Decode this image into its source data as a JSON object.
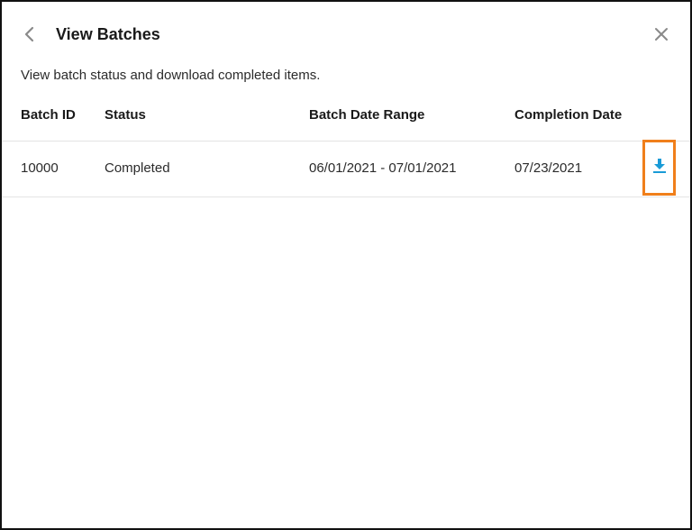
{
  "header": {
    "title": "View Batches",
    "back_icon": "chevron-left-icon",
    "close_icon": "close-icon"
  },
  "subtitle": "View batch status and download completed items.",
  "table": {
    "columns": [
      "Batch ID",
      "Status",
      "Batch Date Range",
      "Completion Date"
    ],
    "rows": [
      {
        "batch_id": "10000",
        "status": "Completed",
        "date_range": "06/01/2021 - 07/01/2021",
        "completion_date": "07/23/2021",
        "action_icon": "download-icon"
      }
    ]
  },
  "colors": {
    "accent": "#1a9bd7",
    "highlight_border": "#f07f1b",
    "icon_gray": "#8a8a8a"
  }
}
